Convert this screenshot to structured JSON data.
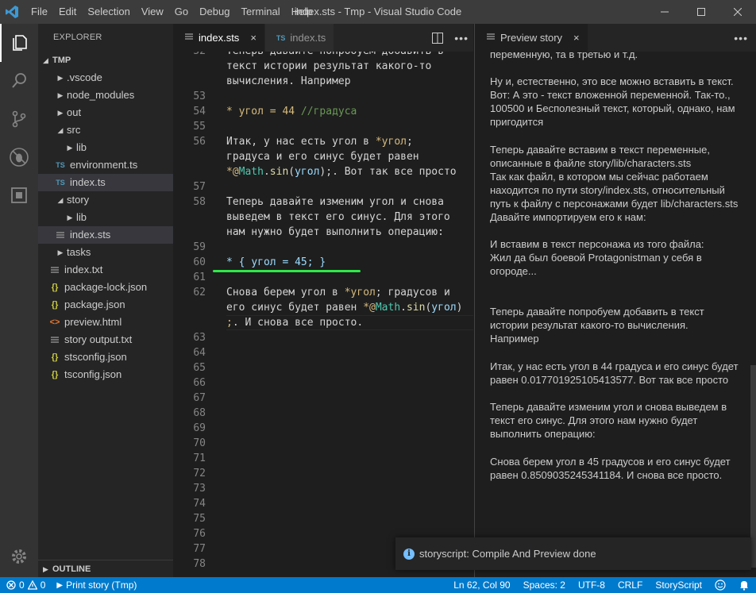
{
  "titlebar": {
    "menu": [
      "File",
      "Edit",
      "Selection",
      "View",
      "Go",
      "Debug",
      "Terminal",
      "Help"
    ],
    "title": "index.sts - Tmp - Visual Studio Code"
  },
  "explorer": {
    "header": "EXPLORER",
    "root": "TMP",
    "items": [
      {
        "label": ".vscode",
        "type": "folder",
        "expanded": false
      },
      {
        "label": "node_modules",
        "type": "folder",
        "expanded": false
      },
      {
        "label": "out",
        "type": "folder",
        "expanded": false
      },
      {
        "label": "src",
        "type": "folder",
        "expanded": true
      },
      {
        "label": "lib",
        "type": "folder",
        "expanded": false
      },
      {
        "label": "environment.ts",
        "type": "ts"
      },
      {
        "label": "index.ts",
        "type": "ts"
      },
      {
        "label": "story",
        "type": "folder",
        "expanded": true
      },
      {
        "label": "lib",
        "type": "folder",
        "expanded": false
      },
      {
        "label": "index.sts",
        "type": "text"
      },
      {
        "label": "tasks",
        "type": "folder",
        "expanded": false
      },
      {
        "label": "index.txt",
        "type": "text"
      },
      {
        "label": "package-lock.json",
        "type": "json"
      },
      {
        "label": "package.json",
        "type": "json"
      },
      {
        "label": "preview.html",
        "type": "html"
      },
      {
        "label": "story output.txt",
        "type": "text"
      },
      {
        "label": "stsconfig.json",
        "type": "json"
      },
      {
        "label": "tsconfig.json",
        "type": "json"
      }
    ],
    "outline": "OUTLINE"
  },
  "editor": {
    "tabs": [
      {
        "label": "index.sts",
        "icon": "lines-icon",
        "close": "×"
      },
      {
        "label": "index.ts",
        "icon": "TS"
      }
    ],
    "line_numbers": {
      "l52": "52",
      "l53": "53",
      "l54": "54",
      "l55": "55",
      "l56": "56",
      "l57": "57",
      "l58": "58",
      "l59": "59",
      "l60": "60",
      "l61": "61",
      "l62": "62",
      "l63": "63",
      "l64": "64",
      "l65": "65",
      "l66": "66",
      "l67": "67",
      "l68": "68",
      "l69": "69",
      "l70": "70",
      "l71": "71",
      "l72": "72",
      "l73": "73",
      "l74": "74",
      "l75": "75",
      "l76": "76",
      "l77": "77",
      "l78": "78"
    },
    "code": {
      "c52a": "Теперь давайте попробуем добавить в",
      "c52b": "текст истории результат какого-то",
      "c52c": "вычисления. Например",
      "c54_star": "*",
      "c54_kw": " угол",
      "c54_eq": " = ",
      "c54_num": "44",
      "c54_com": " //градуса",
      "c56a_1": "Итак, у нас есть угол в ",
      "c56a_2": "*угол",
      "c56a_3": ";",
      "c56b": "градуса и его синус будет равен",
      "c56c_1": "*@",
      "c56c_2": "Math",
      "c56c_3": ".",
      "c56c_4": "sin",
      "c56c_5": "(",
      "c56c_6": "угол",
      "c56c_7": ");",
      "c56c_8": ". Вот так все просто",
      "c58a": "Теперь давайте изменим угол и снова",
      "c58b": "выведем в текст его синус. Для этого",
      "c58c": "нам нужно будет выполнить операцию:",
      "c60_1": "* ",
      "c60_2": "{ ",
      "c60_3": "угол",
      "c60_4": " = ",
      "c60_5": "45",
      "c60_6": "; ",
      "c60_7": "}",
      "c62a_1": "Снова берем угол в ",
      "c62a_2": "*угол",
      "c62a_3": "; градусов и",
      "c62b_1": "его синус будет равен ",
      "c62b_2": "*@",
      "c62b_3": "Math",
      "c62b_4": ".",
      "c62b_5": "sin",
      "c62b_6": "(",
      "c62b_7": "угол",
      "c62b_8": ")",
      "c62c_1": ";",
      "c62c_2": ". И снова все просто."
    }
  },
  "preview": {
    "tab_label": "Preview story",
    "close": "×",
    "paragraphs": {
      "p1": "переменную, та в третью и т.д.",
      "p2": "Ну и, естественно, это все можно вставить в текст.\nВот: А это - текст вложенной переменной. Так-то.,\n100500 и Бесполезный текст, который, однако, нам\nпригодится",
      "p3": "Теперь давайте вставим в текст переменные,\nописанные в файле story/lib/characters.sts\nТак как файл, в котором мы сейчас работаем\nнаходится по пути story/index.sts, относительный\nпуть к файлу с персонажами будет lib/characters.sts\nДавайте импортируем его к нам:",
      "p4": "И вставим в текст персонажа из того файла:\nЖил да был боевой Protagonistman у себя в\nогороде...",
      "p5": "Теперь давайте попробуем добавить в текст\nистории результат какого-то вычисления.\nНапример",
      "p6": "Итак, у нас есть угол в 44 градуса и его синус будет\nравен 0.017701925105413577. Вот так все просто",
      "p7": "Теперь давайте изменим угол и снова выведем в\nтекст его синус. Для этого нам нужно будет\nвыполнить операцию:",
      "p8": "Снова берем угол в 45 градусов и его синус будет\nравен 0.8509035245341184. И снова все просто."
    }
  },
  "notification": {
    "message": "storyscript: Compile And Preview done"
  },
  "statusbar": {
    "errors": "0",
    "warnings": "0",
    "task": "Print story (Tmp)",
    "position": "Ln 62, Col 90",
    "spaces": "Spaces: 2",
    "encoding": "UTF-8",
    "eol": "CRLF",
    "language": "StoryScript"
  },
  "colors": {
    "accent": "#007acc",
    "green_underline": "#2ee94a"
  }
}
